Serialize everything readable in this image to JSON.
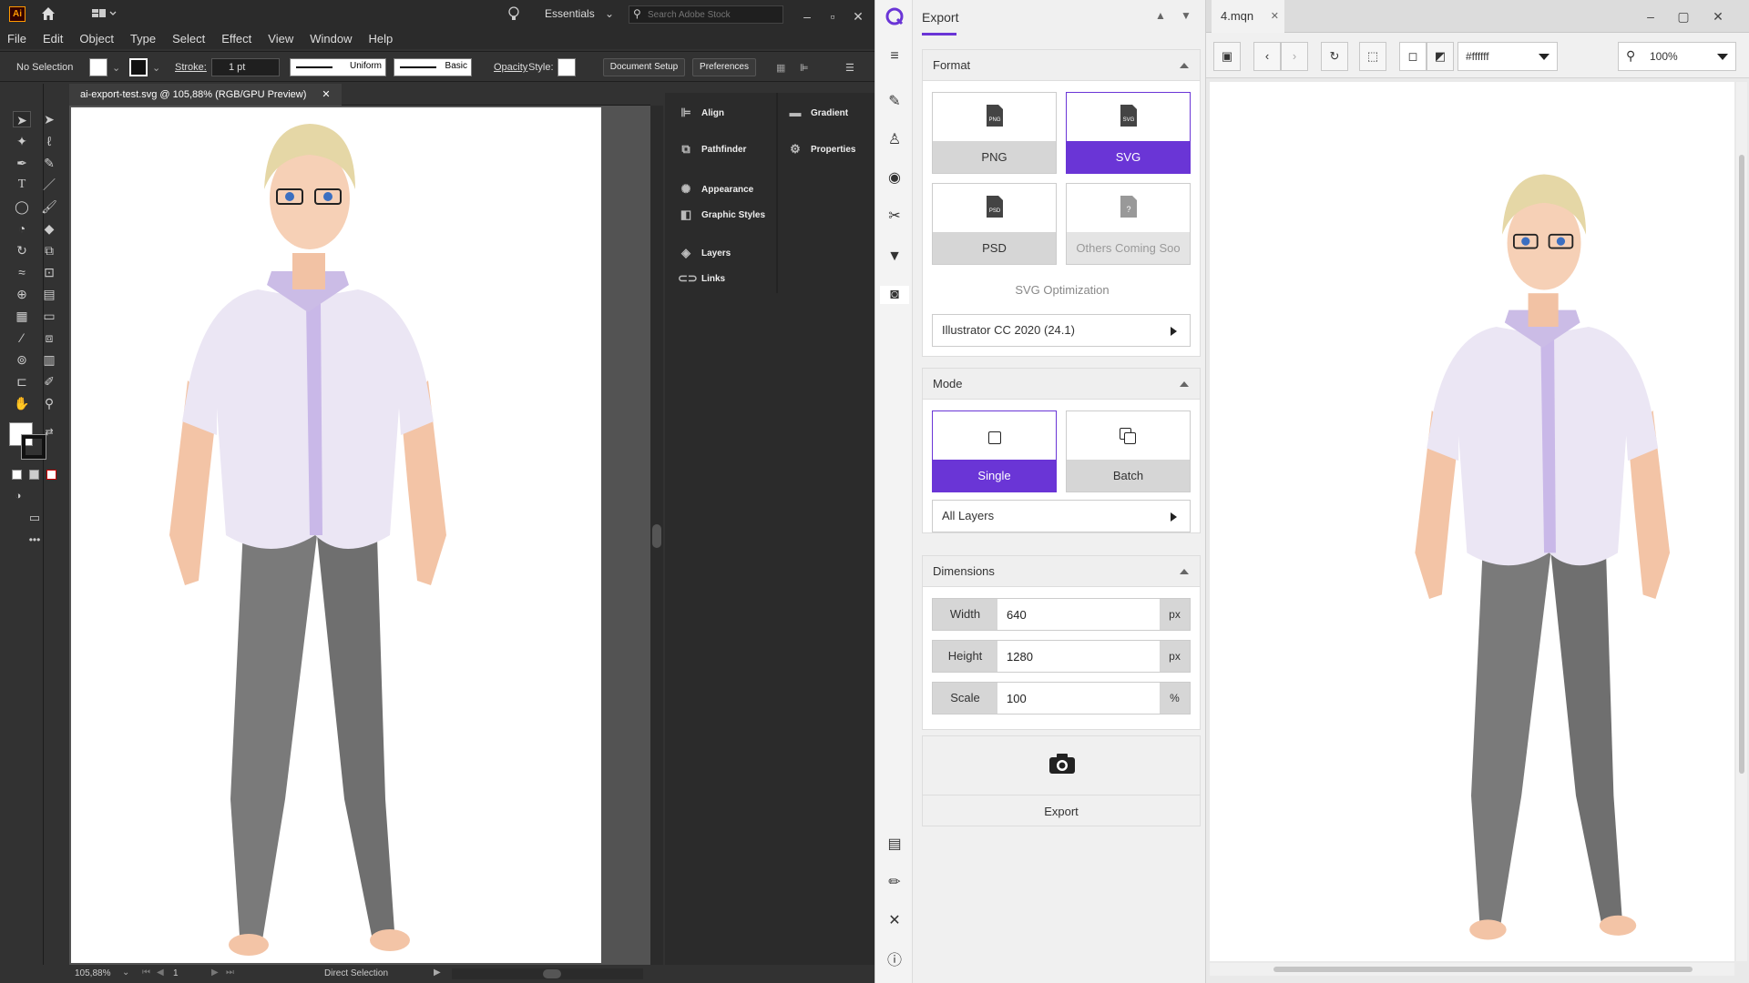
{
  "illustrator": {
    "menu": [
      "File",
      "Edit",
      "Object",
      "Type",
      "Select",
      "Effect",
      "View",
      "Window",
      "Help"
    ],
    "workspace": "Essentials",
    "search_placeholder": "Search Adobe Stock",
    "control": {
      "no_selection": "No Selection",
      "stroke_label": "Stroke:",
      "stroke_value": "1 pt",
      "uniform": "Uniform",
      "basic": "Basic",
      "opacity": "Opacity",
      "style": "Style:",
      "document_setup": "Document Setup",
      "preferences": "Preferences"
    },
    "doc_tab": "ai-export-test.svg @ 105,88% (RGB/GPU Preview)",
    "panels_left": [
      "Align",
      "Pathfinder",
      "Appearance",
      "Graphic Styles",
      "Layers",
      "Links"
    ],
    "panels_right": [
      "Gradient",
      "Properties"
    ],
    "status": {
      "zoom": "105,88%",
      "artboard": "1",
      "tool": "Direct Selection"
    },
    "logo": "Ai",
    "colors": {
      "accent": "#ff9a00"
    }
  },
  "plugin": {
    "title": "Export",
    "format": {
      "heading": "Format",
      "buttons": [
        {
          "label": "PNG",
          "icon": "png-file-icon",
          "state": "normal"
        },
        {
          "label": "SVG",
          "icon": "svg-file-icon",
          "state": "active"
        },
        {
          "label": "PSD",
          "icon": "psd-file-icon",
          "state": "normal"
        },
        {
          "label": "Others Coming Soo",
          "icon": "unknown-file-icon",
          "state": "disabled"
        }
      ],
      "optimization_label": "SVG Optimization",
      "optimization_value": "Illustrator CC 2020 (24.1)"
    },
    "mode": {
      "heading": "Mode",
      "single": "Single",
      "batch": "Batch",
      "layers": "All Layers"
    },
    "dimensions": {
      "heading": "Dimensions",
      "rows": [
        {
          "label": "Width",
          "value": "640",
          "unit": "px"
        },
        {
          "label": "Height",
          "value": "1280",
          "unit": "px"
        },
        {
          "label": "Scale",
          "value": "100",
          "unit": "%"
        }
      ]
    },
    "export_button": "Export",
    "colors": {
      "accent": "#6a35d6"
    }
  },
  "viewer": {
    "tab": "4.mqn",
    "background_color": "#ffffff",
    "zoom": "100%"
  }
}
